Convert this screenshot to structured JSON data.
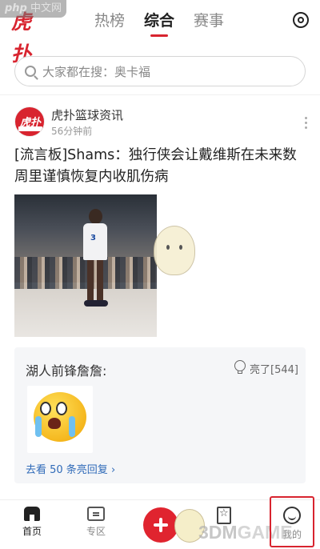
{
  "watermark": {
    "php": "php",
    "cn": "中文网"
  },
  "top_tabs": [
    {
      "label": "热榜",
      "active": false
    },
    {
      "label": "综合",
      "active": true
    },
    {
      "label": "赛事",
      "active": false
    }
  ],
  "logo_text": "虎扑",
  "search": {
    "placeholder": "大家都在搜：奥卡福"
  },
  "post": {
    "author": "虎扑篮球资讯",
    "avatar_text": "虎扑",
    "time": "56分钟前",
    "title": "[流言板]Shams：独行侠会让戴维斯在未来数周里谨慎恢复内收肌伤病",
    "jersey_number": "3"
  },
  "comment": {
    "user": "湖人前锋詹詹:",
    "light_count": "亮了[544]",
    "replies_link": "去看 50 条亮回复 ›"
  },
  "bottom_nav": {
    "home": "首页",
    "zone": "专区",
    "favorites": "",
    "me": "我的"
  },
  "brand_mark": {
    "d": "3DM",
    "rest": "GAME"
  },
  "colors": {
    "accent": "#d8242f",
    "link": "#2f6ab8"
  }
}
